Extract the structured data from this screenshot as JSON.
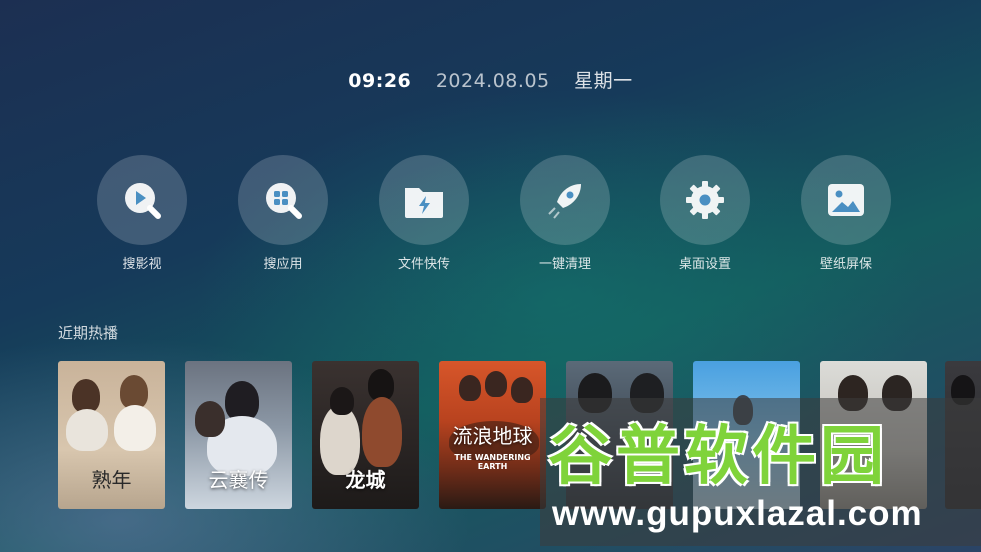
{
  "clock": {
    "time": "09:26",
    "date": "2024.08.05",
    "weekday": "星期一"
  },
  "apps": [
    {
      "label": "搜影视",
      "icon": "search-video-icon"
    },
    {
      "label": "搜应用",
      "icon": "search-app-icon"
    },
    {
      "label": "文件快传",
      "icon": "file-transfer-icon"
    },
    {
      "label": "一键清理",
      "icon": "rocket-clean-icon"
    },
    {
      "label": "桌面设置",
      "icon": "gear-icon"
    },
    {
      "label": "壁纸屏保",
      "icon": "wallpaper-icon"
    }
  ],
  "recent": {
    "title": "近期热播",
    "posters": [
      {
        "title": "熟年",
        "sub": ""
      },
      {
        "title": "云襄传",
        "sub": ""
      },
      {
        "title": "龙城",
        "sub": ""
      },
      {
        "title": "流浪地球",
        "sub": "THE WANDERING EARTH"
      },
      {
        "title": "",
        "sub": ""
      },
      {
        "title": "",
        "sub": ""
      },
      {
        "title": "",
        "sub": ""
      },
      {
        "title": "",
        "sub": ""
      }
    ]
  },
  "watermark": {
    "cn": "谷普软件园",
    "url": "www.gupuxlazal.com"
  },
  "colors": {
    "accent_green": "#7fd33a",
    "icon_circle": "#ffffff2e"
  }
}
